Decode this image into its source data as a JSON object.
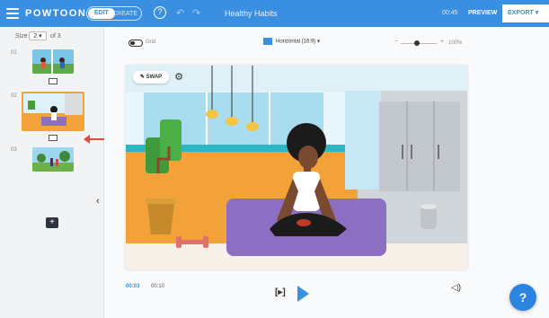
{
  "header": {
    "logo": "POWTOON",
    "mode_edit": "EDIT",
    "mode_other": "CREATE",
    "help_label": "?",
    "undo_icon": "undo-icon",
    "redo_icon": "redo-icon",
    "title": "Healthy Habits",
    "time": "00:45",
    "preview_label": "PREVIEW",
    "export_label": "EXPORT"
  },
  "sidebar": {
    "size_label": "Size",
    "size_value": "2 ▾",
    "of_label": "of 3",
    "slides": [
      {
        "number": "01"
      },
      {
        "number": "02"
      },
      {
        "number": "03"
      }
    ],
    "add_label": "+",
    "collapse_label": "‹"
  },
  "toolbar": {
    "grid_label": "Grid",
    "canvas_size": "Horizontal (16:9)",
    "zoom_minus": "−",
    "zoom_plus": "+",
    "zoom_pct": "100%"
  },
  "canvas": {
    "swap_label": "✎ SWAP",
    "gear_icon": "⚙"
  },
  "timeline": {
    "current": "00:03",
    "total": "00:10",
    "step_label": "[▸]",
    "volume_icon": "◁)"
  },
  "help_button": "?",
  "colors": {
    "brand": "#3b8fe0",
    "accent_arrow": "#e04a3a",
    "mat": "#8c6fc2",
    "floor": "#f3a23a"
  }
}
